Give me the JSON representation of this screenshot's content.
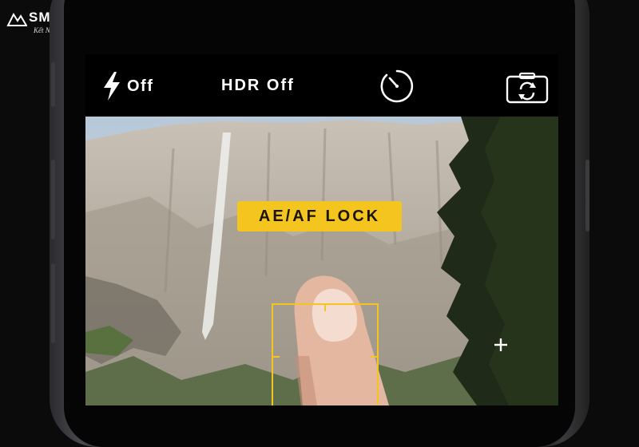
{
  "brand": {
    "name": "SMART",
    "slogan": "Kết Nối Đam Mê",
    "logo_icon": "mountain-logo-icon"
  },
  "camera": {
    "flash": {
      "icon": "lightning-icon",
      "label": "Off"
    },
    "hdr": {
      "label": "HDR Off"
    },
    "timer": {
      "icon": "timer-icon"
    },
    "switch_camera": {
      "icon": "switch-camera-icon"
    },
    "lock_badge": {
      "label": "AE/AF LOCK"
    },
    "exposure": {
      "icon": "plus-icon"
    }
  },
  "colors": {
    "accent": "#f4c51e",
    "bar": "#000000",
    "text": "#ffffff"
  }
}
